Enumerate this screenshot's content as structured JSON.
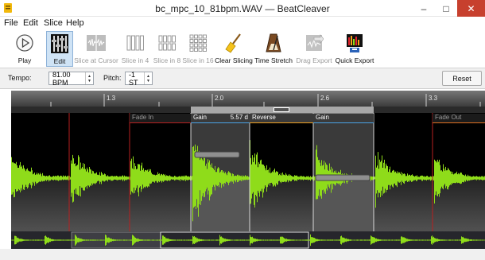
{
  "window": {
    "title": "bc_mpc_10_81bpm.WAV — BeatCleaver",
    "min_glyph": "–",
    "max_glyph": "□",
    "close_glyph": "✕"
  },
  "menu": {
    "items": [
      "File",
      "Edit",
      "Slice",
      "Help"
    ]
  },
  "toolbar": {
    "play": "Play",
    "edit": "Edit",
    "slice_at_cursor": "Slice at Cursor",
    "slice_in_4": "Slice in 4",
    "slice_in_8": "Slice in 8",
    "slice_in_16": "Slice in 16",
    "clear_slicing": "Clear Slicing",
    "time_stretch": "Time Stretch",
    "drag_export": "Drag Export",
    "quick_export": "Quick Export"
  },
  "controls": {
    "tempo_label": "Tempo:",
    "tempo_value": "81.00 BPM",
    "pitch_label": "Pitch:",
    "pitch_value": "-1 ST",
    "reset": "Reset"
  },
  "ruler": {
    "labels": [
      "1.3",
      "2.0",
      "2.6",
      "3.3"
    ]
  },
  "slices": {
    "fade_in": "Fade In",
    "gain1": "Gain",
    "gain1_value": "5.57 d",
    "reverse": "Reverse",
    "gain2": "Gain",
    "fade_out": "Fade Out"
  },
  "gain_levels": {
    "slice_gain_1": 0.35,
    "slice_gain_2": 0.55
  },
  "colors": {
    "waveform": "#8fdc1a",
    "slice_line": "#b82020",
    "gain_accent": "#4aa3e6",
    "reverse_accent": "#f0a020",
    "fade_out_accent": "#e07020",
    "close_button": "#c7402e"
  },
  "icons": {
    "play": "play-circle-icon",
    "edit": "edit-sliders-icon",
    "clear_slicing": "broom-icon",
    "time_stretch": "metronome-icon",
    "drag_export": "drag-export-icon",
    "quick_export": "quick-export-icon"
  }
}
